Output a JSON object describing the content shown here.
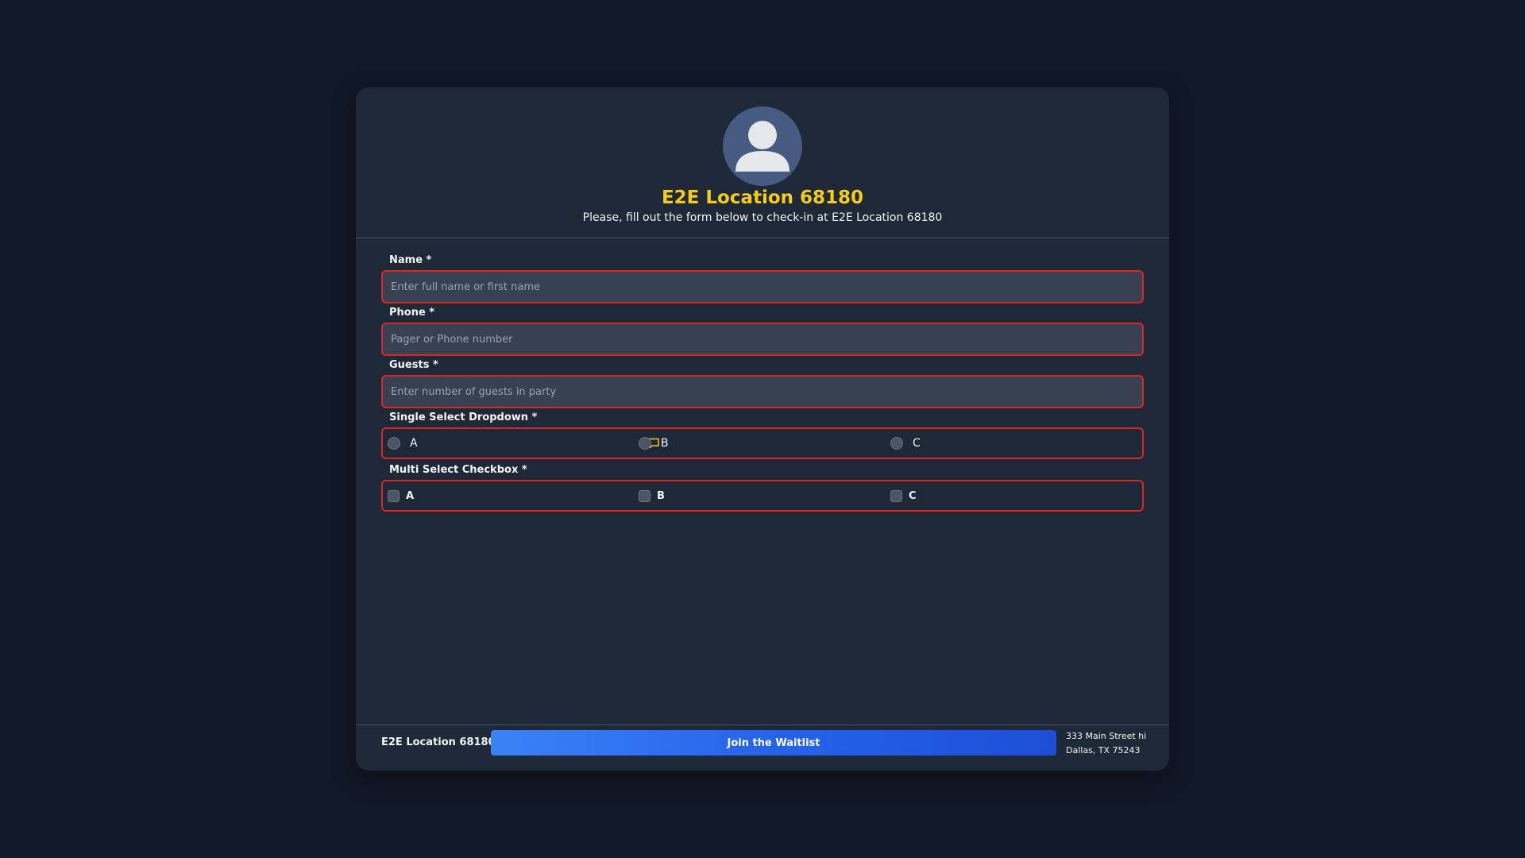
{
  "header": {
    "title": "E2E Location 68180",
    "subtitle": "Please, fill out the form below to check-in at E2E Location 68180",
    "avatar_icon": "user-avatar-icon"
  },
  "form": {
    "name": {
      "label": "Name *",
      "placeholder": "Enter full name or first name",
      "value": ""
    },
    "phone": {
      "label": "Phone *",
      "placeholder": "Pager or Phone number",
      "value": ""
    },
    "guests": {
      "label": "Guests *",
      "placeholder": "Enter number of guests in party",
      "value": ""
    },
    "single_select": {
      "label": "Single Select Dropdown *",
      "options": [
        "A",
        "B",
        "C"
      ]
    },
    "multi_select": {
      "label": "Multi Select Checkbox *",
      "options": [
        "A",
        "B",
        "C"
      ]
    }
  },
  "footer": {
    "location_name": "E2E Location 68180",
    "join_label": "Join the Waitlist",
    "address_line1": "333 Main Street hi",
    "address_line2": "Dallas, TX 75243"
  },
  "colors": {
    "background": "#111827",
    "card": "#1e2937",
    "accent_title": "#facc15",
    "error_border": "#dc2626",
    "button": "#2563eb"
  }
}
